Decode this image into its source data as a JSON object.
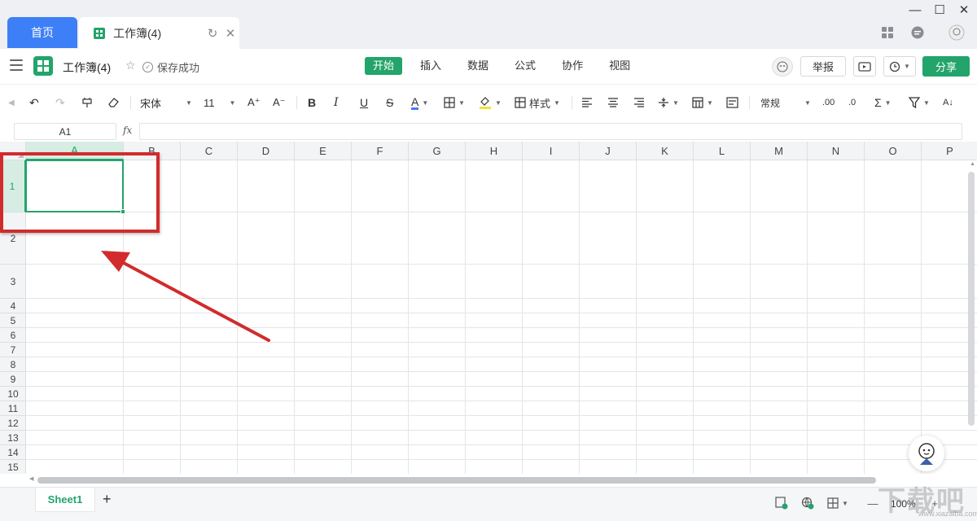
{
  "tabs": {
    "home_label": "首页",
    "workbook_label": "工作簿(4)"
  },
  "appbar": {
    "doc_title": "工作簿(4)",
    "save_status": "保存成功",
    "menu": [
      "开始",
      "插入",
      "数据",
      "公式",
      "协作",
      "视图"
    ],
    "active_menu": "开始",
    "report_label": "举报",
    "share_label": "分享"
  },
  "toolbar": {
    "font_name": "宋体",
    "font_size": "11",
    "style_label": "样式",
    "number_format": "常规"
  },
  "formula": {
    "cell_ref": "A1",
    "fx_label": "fx",
    "value": ""
  },
  "grid": {
    "columns": [
      "A",
      "B",
      "C",
      "D",
      "E",
      "F",
      "G",
      "H",
      "I",
      "J",
      "K",
      "L",
      "M",
      "N",
      "O",
      "P"
    ],
    "rows": [
      "1",
      "2",
      "3",
      "4",
      "5",
      "6",
      "7",
      "8",
      "9",
      "10",
      "11",
      "12",
      "13",
      "14",
      "15"
    ],
    "selected_cell": "A1"
  },
  "sheetbar": {
    "sheet_name": "Sheet1",
    "zoom": "100%"
  },
  "watermark": {
    "text": "下载吧",
    "sub": "www.xiazaiba.com"
  },
  "colors": {
    "accent": "#23a46b",
    "home_tab": "#3d7ff6",
    "annotation": "#d22b2b"
  }
}
